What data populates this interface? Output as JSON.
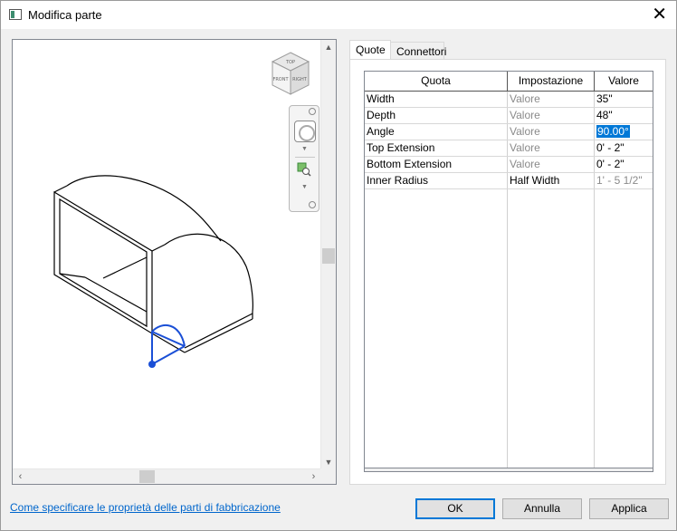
{
  "window": {
    "title": "Modifica parte",
    "close_glyph": "✕"
  },
  "tabs": [
    {
      "label": "Quote"
    },
    {
      "label": "Connettori"
    }
  ],
  "table": {
    "headers": [
      "Quota",
      "Impostazione",
      "Valore"
    ],
    "rows": [
      {
        "name": "Width",
        "setting": "Valore",
        "value": "35\""
      },
      {
        "name": "Depth",
        "setting": "Valore",
        "value": "48\""
      },
      {
        "name": "Angle",
        "setting": "Valore",
        "value": "90.00°"
      },
      {
        "name": "Top Extension",
        "setting": "Valore",
        "value": "0' - 2\""
      },
      {
        "name": "Bottom Extension",
        "setting": "Valore",
        "value": "0' - 2\""
      },
      {
        "name": "Inner Radius",
        "setting": "Half Width",
        "value": "1' - 5 1/2\""
      }
    ]
  },
  "viewcube": {
    "faces": [
      "TOP",
      "FRONT",
      "RIGHT"
    ]
  },
  "footer": {
    "help_link": "Come specificare le proprietà delle parti di fabbricazione",
    "ok": "OK",
    "cancel": "Annulla",
    "apply": "Applica"
  },
  "colors": {
    "accent": "#0078d7",
    "link": "#0066cc",
    "sketch_blue": "#1a4fd6"
  }
}
